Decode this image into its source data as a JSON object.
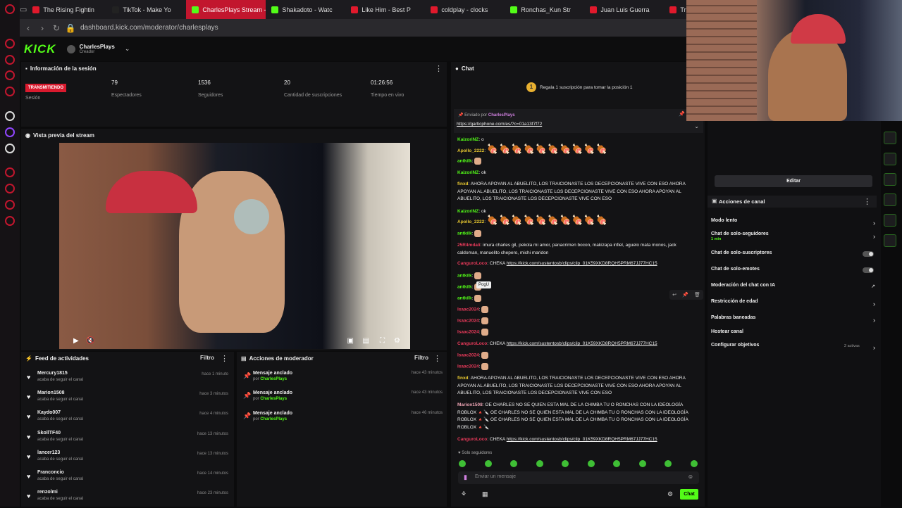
{
  "tabs": [
    {
      "label": "The Rising Fightin",
      "color": "#e1192c",
      "active": false
    },
    {
      "label": "TikTok - Make Yo",
      "color": "#222222",
      "active": false
    },
    {
      "label": "CharlesPlays Stream - K",
      "color": "#53fc18",
      "active": true
    },
    {
      "label": "Shakadoto - Watc",
      "color": "#53fc18",
      "active": false
    },
    {
      "label": "Like Him - Best P",
      "color": "#e1192c",
      "active": false
    },
    {
      "label": "coldplay - clocks",
      "color": "#e1192c",
      "active": false
    },
    {
      "label": "Ronchas_Kun Str",
      "color": "#53fc18",
      "active": false
    },
    {
      "label": "Juan Luis Guerra",
      "color": "#e1192c",
      "active": false
    },
    {
      "label": "Transformers: Re",
      "color": "#e1192c",
      "active": false
    }
  ],
  "url": "dashboard.kick.com/moderator/charlesplays",
  "header": {
    "logo": "KICK",
    "channel": "CharlesPlays",
    "role": "Creador"
  },
  "session": {
    "title": "Información de la sesión",
    "status": "TRANSMITIENDO",
    "status_label": "Sesión",
    "stats": [
      {
        "value": "79",
        "label": "Espectadores"
      },
      {
        "value": "1536",
        "label": "Seguidores"
      },
      {
        "value": "20",
        "label": "Cantidad de suscripciones"
      },
      {
        "value": "01:26:56",
        "label": "Tiempo en vivo"
      }
    ]
  },
  "preview": {
    "title": "Vista previa del stream"
  },
  "feed": {
    "title": "Feed de actividades",
    "filter": "Filtro",
    "items": [
      {
        "name": "Mercury1815",
        "sub": "acaba de seguir el canal",
        "time": "hace 1 minuto"
      },
      {
        "name": "Marion1508",
        "sub": "acaba de seguir el canal",
        "time": "hace 3 minutos"
      },
      {
        "name": "Kaydo007",
        "sub": "acaba de seguir el canal",
        "time": "hace 4 minutos"
      },
      {
        "name": "SkollTF40",
        "sub": "acaba de seguir el canal",
        "time": "hace 13 minutos"
      },
      {
        "name": "lancer123",
        "sub": "acaba de seguir el canal",
        "time": "hace 13 minutos"
      },
      {
        "name": "Franconcio",
        "sub": "acaba de seguir el canal",
        "time": "hace 14 minutos"
      },
      {
        "name": "renzolmi",
        "sub": "acaba de seguir el canal",
        "time": "hace 23 minutos"
      }
    ]
  },
  "modactions": {
    "title": "Acciones de moderador",
    "filter": "Filtro",
    "items": [
      {
        "name": "Mensaje anclado",
        "by": "por",
        "user": "CharlesPlays",
        "time": "hace 43 minutos"
      },
      {
        "name": "Mensaje anclado",
        "by": "por",
        "user": "CharlesPlays",
        "time": "hace 43 minutos"
      },
      {
        "name": "Mensaje anclado",
        "by": "por",
        "user": "CharlesPlays",
        "time": "hace 46 minutos"
      }
    ]
  },
  "chat": {
    "title": "Chat",
    "gift_banner": "Regala 1 suscripción para tomar la posición 1",
    "pinned_by": "Enviado por",
    "pinned_user": "CharlesPlays",
    "pinned_link": "https://garticphone.com/es/?c=01a13f7f72",
    "messages": [
      {
        "user": "KaizoriNZ",
        "color": "#53fc18",
        "text": "o"
      },
      {
        "user": "Apollo_2222",
        "color": "#e8c830",
        "text": "",
        "hams": 10
      },
      {
        "user": "antkilk",
        "color": "#53fc18",
        "text": "",
        "emote": true
      },
      {
        "user": "KaizoriNZ",
        "color": "#53fc18",
        "text": "ok"
      },
      {
        "user": "finxd",
        "color": "#e8c830",
        "text": "AHORA APOYAN AL ABUELITO, LOS TRAICIONASTE LOS DECEPCIONASTE VIVE CON ESO AHORA APOYAN AL ABUELITO, LOS TRAICIONASTE LOS DECEPCIONASTE VIVE CON ESO AHORA APOYAN AL ABUELITO, LOS TRAICIONASTE LOS DECEPCIONASTE VIVE CON ESO"
      },
      {
        "user": "KaizoriNZ",
        "color": "#53fc18",
        "text": "ok"
      },
      {
        "user": "Apollo_2222",
        "color": "#e8c830",
        "text": "",
        "hams": 10
      },
      {
        "user": "antkilk",
        "color": "#53fc18",
        "text": "",
        "emote": true
      },
      {
        "user": "25R4mdali",
        "color": "#e83a5a",
        "text": "imura charles gil, pekola mi amor, panacrimen bocon, makizapa infiel, aguelo mata monos, jack caldoman, manuelito chepero, michi maridon"
      },
      {
        "user": "CanguroLoco",
        "color": "#e83a5a",
        "text": "CHEKA",
        "link": "https://kick.com/sustentosb/clips/clip_01K59XKD8RQH5PRM67JJ77HC15"
      },
      {
        "user": "antkilk",
        "color": "#53fc18",
        "text": "",
        "emote": true
      },
      {
        "user": "antkilk",
        "color": "#53fc18",
        "text": "",
        "emote": true
      },
      {
        "user": "antkilk",
        "color": "#53fc18",
        "text": "",
        "emote": true
      },
      {
        "user": "Isaac2024",
        "color": "#e83a5a",
        "text": "",
        "emote": true
      },
      {
        "user": "Isaac2024",
        "color": "#e83a5a",
        "text": "",
        "emote": true
      },
      {
        "user": "Isaac2024",
        "color": "#e83a5a",
        "text": "",
        "emote": true
      },
      {
        "user": "CanguroLoco",
        "color": "#e83a5a",
        "text": "CHEKA",
        "link": "https://kick.com/sustentosb/clips/clip_01K59XKD8RQH5PRM67JJ77HC15"
      },
      {
        "user": "Isaac2024",
        "color": "#e83a5a",
        "text": "",
        "emote": true
      },
      {
        "user": "Isaac2024",
        "color": "#e83a5a",
        "text": "",
        "emote": true
      },
      {
        "user": "finxd",
        "color": "#e8c830",
        "text": "AHORA APOYAN AL ABUELITO, LOS TRAICIONASTE LOS DECEPCIONASTE VIVE CON ESO AHORA APOYAN AL ABUELITO, LOS TRAICIONASTE LOS DECEPCIONASTE VIVE CON ESO AHORA APOYAN AL ABUELITO, LOS TRAICIONASTE LOS DECEPCIONASTE VIVE CON ESO"
      },
      {
        "user": "Marion1508",
        "color": "#e8a0b0",
        "text": "OE CHARLES NO SE QUIEN ESTA MAL DE LA CHIMBA TU O RONCHAS CON LA IDEOLOGÍA ROBLOX 🔺🔪 OE CHARLES NO SE QUIEN ESTA MAL DE LA CHIMBA TU O RONCHAS CON LA IDEOLOGÍA ROBLOX 🔺🔪 OE CHARLES NO SE QUIEN ESTA MAL DE LA CHIMBA TU O RONCHAS CON LA IDEOLOGÍA ROBLOX 🔺🔪"
      },
      {
        "user": "CanguroLoco",
        "color": "#e83a5a",
        "text": "CHEKA",
        "link": "https://kick.com/sustentosb/clips/clip_01K59XKD8RQH5PRM67JJ77HC15"
      }
    ],
    "tooltip": "PogU",
    "followers_only": "Solo seguidores",
    "placeholder": "Enviar un mensaje",
    "send": "Chat"
  },
  "right": {
    "edit": "Editar",
    "title": "Acciones de canal",
    "options": [
      {
        "label": "Modo lento",
        "kind": "chevron"
      },
      {
        "label": "Chat de solo-seguidores",
        "sub": "1 min",
        "kind": "chevron"
      },
      {
        "label": "Chat de solo-suscriptores",
        "kind": "toggle"
      },
      {
        "label": "Chat de solo-emotes",
        "kind": "toggle"
      },
      {
        "label": "Moderación del chat con IA",
        "kind": "link"
      },
      {
        "label": "Restricción de edad",
        "kind": "chevron"
      },
      {
        "label": "Palabras baneadas",
        "kind": "chevron"
      },
      {
        "label": "Hostear canal",
        "kind": "none"
      },
      {
        "label": "Configurar objetivos",
        "sub_right": "2 activas",
        "kind": "chevron"
      }
    ]
  }
}
